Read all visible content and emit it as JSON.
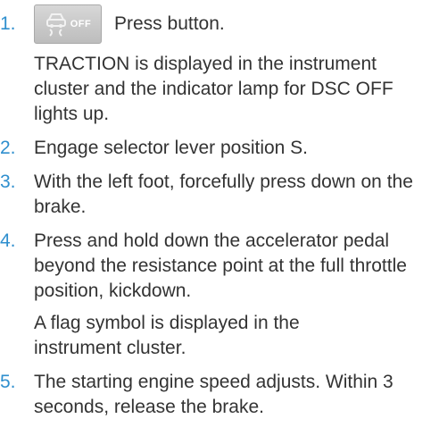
{
  "steps": [
    {
      "number": "1.",
      "icon": "dsc-off-button-icon",
      "icon_label": "OFF",
      "text": "Press button.",
      "note": "TRACTION is displayed in the instrument cluster and the indicator lamp for DSC OFF lights up."
    },
    {
      "number": "2.",
      "text": "Engage selector lever position S."
    },
    {
      "number": "3.",
      "text": "With the left foot, forcefully press down on the brake."
    },
    {
      "number": "4.",
      "text": "Press and hold down the accelerator pedal beyond the resistance point at the full throttle position, kickdown.",
      "note": "A flag symbol is displayed in the instrument cluster."
    },
    {
      "number": "5.",
      "text": "The starting engine speed adjusts. Within 3 seconds, release the brake."
    }
  ],
  "colors": {
    "number": "#2f8fce",
    "text": "#333333"
  }
}
